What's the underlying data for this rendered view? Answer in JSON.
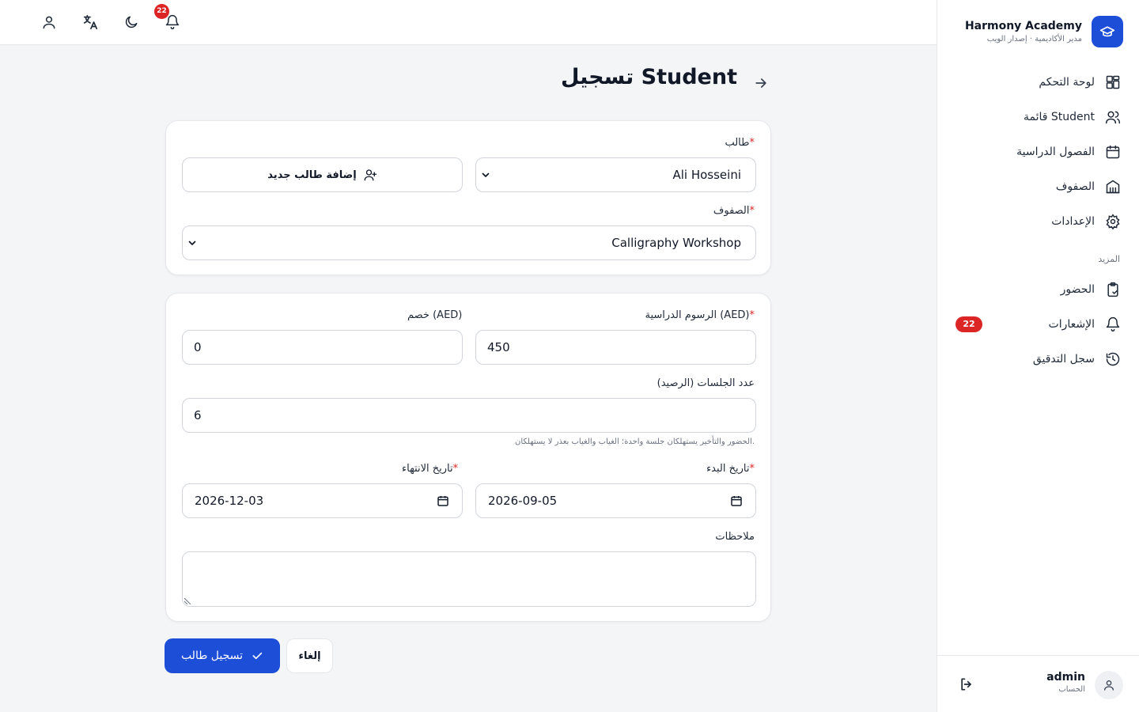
{
  "brand": {
    "title": "Harmony Academy",
    "subtitle": "مدير الأكاديمية · إصدار الويب"
  },
  "sidebar": {
    "items": [
      {
        "label": "لوحة التحكم",
        "icon": "dashboard-icon"
      },
      {
        "label": "قائمة Student",
        "icon": "users-icon"
      },
      {
        "label": "الفصول الدراسية",
        "icon": "calendar-icon"
      },
      {
        "label": "الصفوف",
        "icon": "building-icon"
      },
      {
        "label": "الإعدادات",
        "icon": "gear-icon"
      }
    ],
    "more_heading": "المزيد",
    "more_items": [
      {
        "label": "الحضور",
        "icon": "clipboard-icon"
      },
      {
        "label": "الإشعارات",
        "icon": "bell-icon",
        "badge": "22"
      },
      {
        "label": "سجل التدقيق",
        "icon": "history-icon"
      }
    ]
  },
  "account": {
    "name": "admin",
    "role": "الحساب"
  },
  "topbar": {
    "notification_count": "22"
  },
  "page": {
    "title": "تسجيل Student"
  },
  "form": {
    "student_label": "طالب",
    "student_value": "Ali Hosseini",
    "add_student_label": "إضافة طالب جديد",
    "class_label": "الصفوف",
    "class_value": "Calligraphy Workshop",
    "tuition_label": "الرسوم الدراسية (AED)",
    "tuition_value": "450",
    "discount_label": "خصم (AED)",
    "discount_value": "0",
    "sessions_label": "عدد الجلسات (الرصيد)",
    "sessions_value": "6",
    "sessions_hint": "الحضور والتأخير يستهلكان جلسة واحدة؛ الغياب والغياب بعذر لا يستهلكان.",
    "start_label": "تاريخ البدء",
    "start_value": "2026-09-05",
    "end_label": "تاريخ الانتهاء",
    "end_value": "2026-12-03",
    "notes_label": "ملاحظات",
    "notes_value": "",
    "required_mark": "*"
  },
  "actions": {
    "submit_label": "تسجيل طالب",
    "cancel_label": "إلغاء"
  },
  "colors": {
    "primary": "#1d4ed8",
    "danger": "#dc2626",
    "background": "#f4f5f7"
  }
}
